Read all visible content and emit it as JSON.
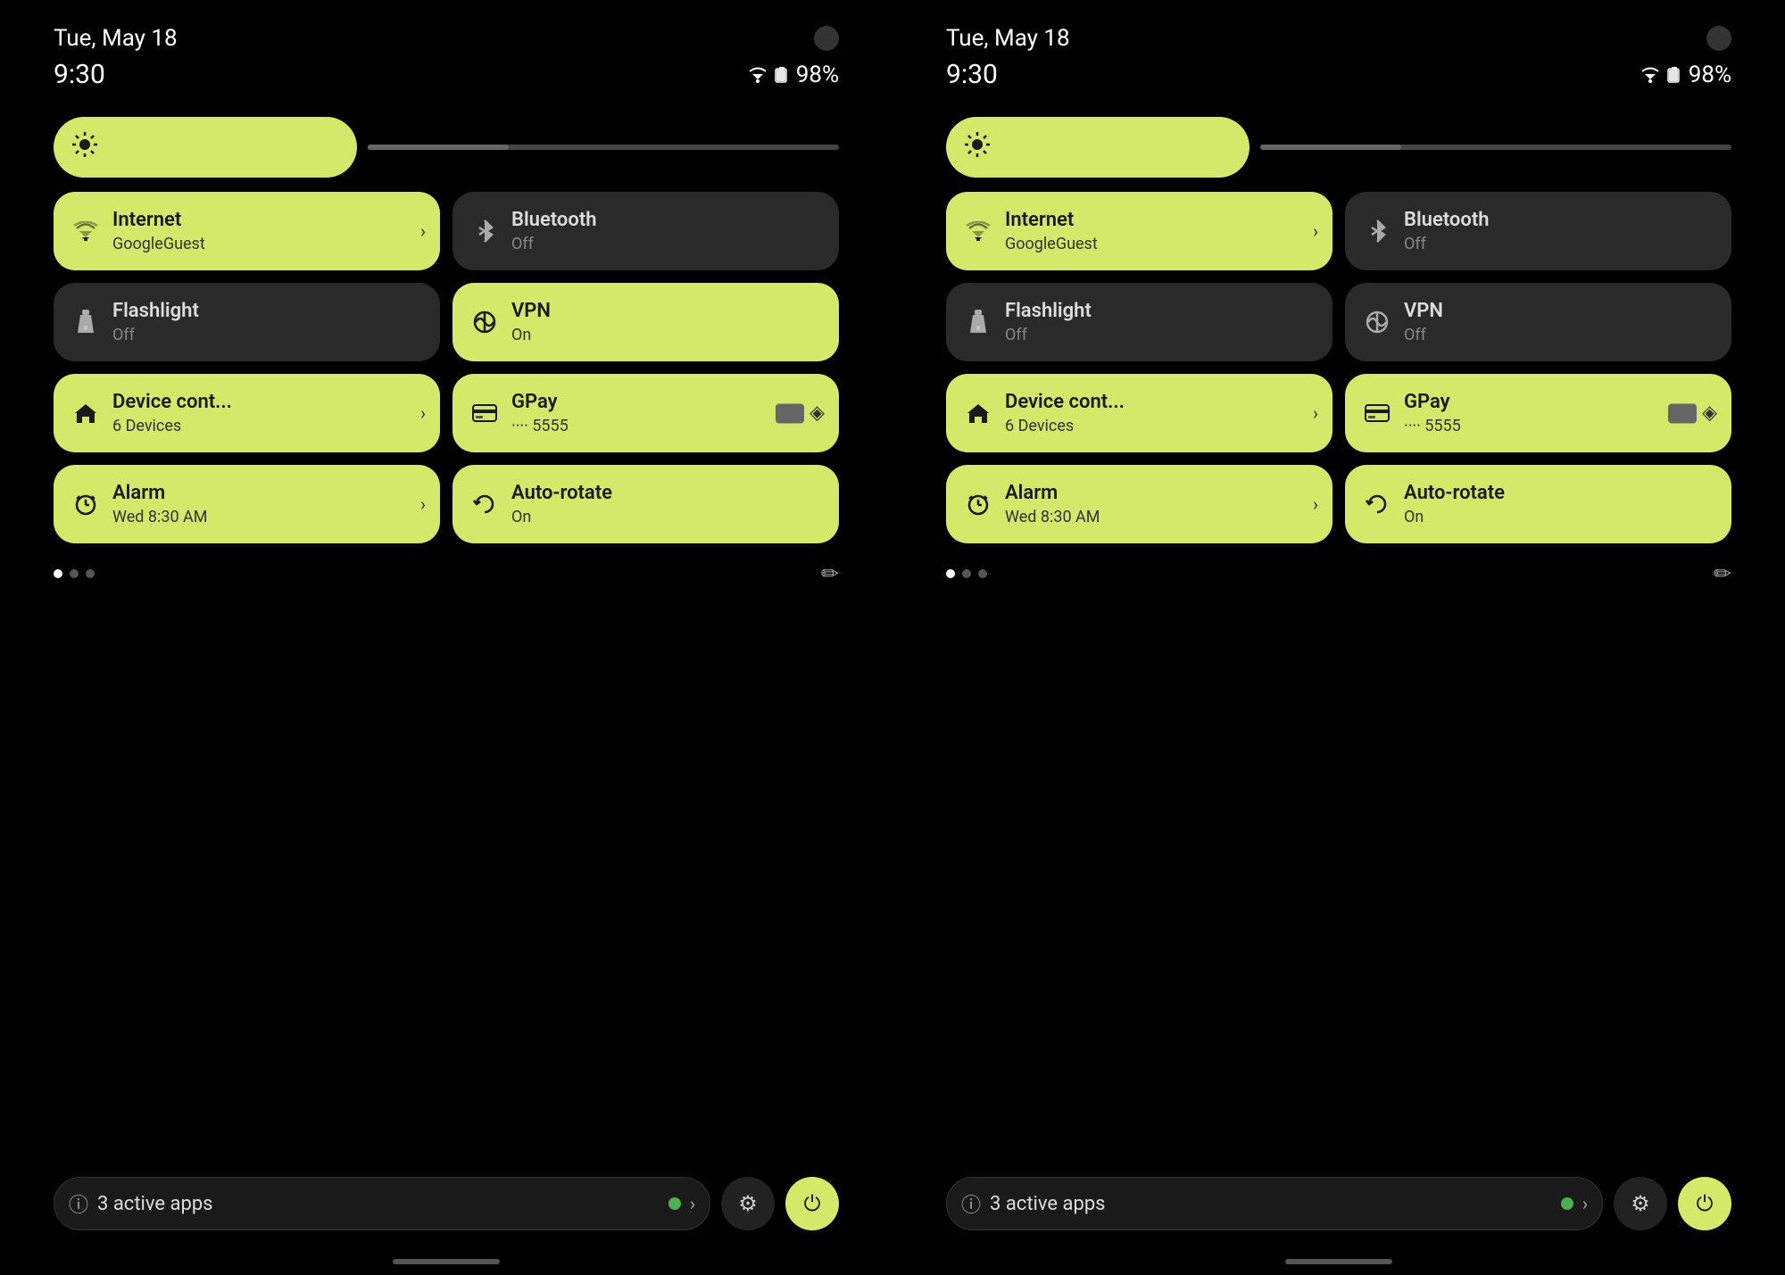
{
  "screens": [
    {
      "id": "screen-left",
      "statusBar": {
        "date": "Tue, May 18",
        "time": "9:30",
        "battery": "98%"
      },
      "brightness": {
        "icon": "⚙"
      },
      "tiles": [
        {
          "id": "internet",
          "title": "Internet",
          "subtitle": "GoogleGuest",
          "state": "active",
          "icon": "wifi",
          "hasArrow": true
        },
        {
          "id": "bluetooth",
          "title": "Bluetooth",
          "subtitle": "Off",
          "state": "inactive",
          "icon": "bluetooth",
          "hasArrow": false
        },
        {
          "id": "flashlight",
          "title": "Flashlight",
          "subtitle": "Off",
          "state": "inactive",
          "icon": "flashlight",
          "hasArrow": false
        },
        {
          "id": "vpn",
          "title": "VPN",
          "subtitle": "On",
          "state": "active",
          "icon": "vpn",
          "hasArrow": false
        },
        {
          "id": "device-control",
          "title": "Device cont...",
          "subtitle": "6 Devices",
          "state": "active",
          "icon": "home",
          "hasArrow": true
        },
        {
          "id": "gpay",
          "title": "GPay",
          "subtitle": "···· 5555",
          "state": "active",
          "icon": "card",
          "hasArrow": false,
          "hasCard": true
        },
        {
          "id": "alarm",
          "title": "Alarm",
          "subtitle": "Wed 8:30 AM",
          "state": "active",
          "icon": "alarm",
          "hasArrow": true
        },
        {
          "id": "autorotate",
          "title": "Auto-rotate",
          "subtitle": "On",
          "state": "active",
          "icon": "rotate",
          "hasArrow": false
        }
      ],
      "pagination": {
        "dots": [
          "active",
          "inactive",
          "inactive"
        ]
      },
      "bottomBar": {
        "activeAppsCount": "3",
        "activeAppsLabel": "active apps"
      }
    },
    {
      "id": "screen-right",
      "statusBar": {
        "date": "Tue, May 18",
        "time": "9:30",
        "battery": "98%"
      },
      "brightness": {
        "icon": "⚙"
      },
      "tiles": [
        {
          "id": "internet",
          "title": "Internet",
          "subtitle": "GoogleGuest",
          "state": "active",
          "icon": "wifi",
          "hasArrow": true
        },
        {
          "id": "bluetooth",
          "title": "Bluetooth",
          "subtitle": "Off",
          "state": "inactive",
          "icon": "bluetooth",
          "hasArrow": false
        },
        {
          "id": "flashlight",
          "title": "Flashlight",
          "subtitle": "Off",
          "state": "inactive",
          "icon": "flashlight",
          "hasArrow": false
        },
        {
          "id": "vpn",
          "title": "VPN",
          "subtitle": "Off",
          "state": "inactive",
          "icon": "vpn",
          "hasArrow": false
        },
        {
          "id": "device-control",
          "title": "Device cont...",
          "subtitle": "6 Devices",
          "state": "active",
          "icon": "home",
          "hasArrow": true
        },
        {
          "id": "gpay",
          "title": "GPay",
          "subtitle": "···· 5555",
          "state": "active",
          "icon": "card",
          "hasArrow": false,
          "hasCard": true
        },
        {
          "id": "alarm",
          "title": "Alarm",
          "subtitle": "Wed 8:30 AM",
          "state": "active",
          "icon": "alarm",
          "hasArrow": true
        },
        {
          "id": "autorotate",
          "title": "Auto-rotate",
          "subtitle": "On",
          "state": "active",
          "icon": "rotate",
          "hasArrow": false
        }
      ],
      "pagination": {
        "dots": [
          "active",
          "inactive",
          "inactive"
        ]
      },
      "bottomBar": {
        "activeAppsCount": "3",
        "activeAppsLabel": "active apps"
      }
    }
  ],
  "icons": {
    "wifi": "▼",
    "bluetooth": "✱",
    "flashlight": "🔦",
    "vpn": "◎",
    "home": "⌂",
    "card": "💳",
    "alarm": "◷",
    "rotate": "↻",
    "edit": "✏",
    "info": "ⓘ",
    "settings": "⚙",
    "power": "⏻",
    "chevron": "›"
  }
}
